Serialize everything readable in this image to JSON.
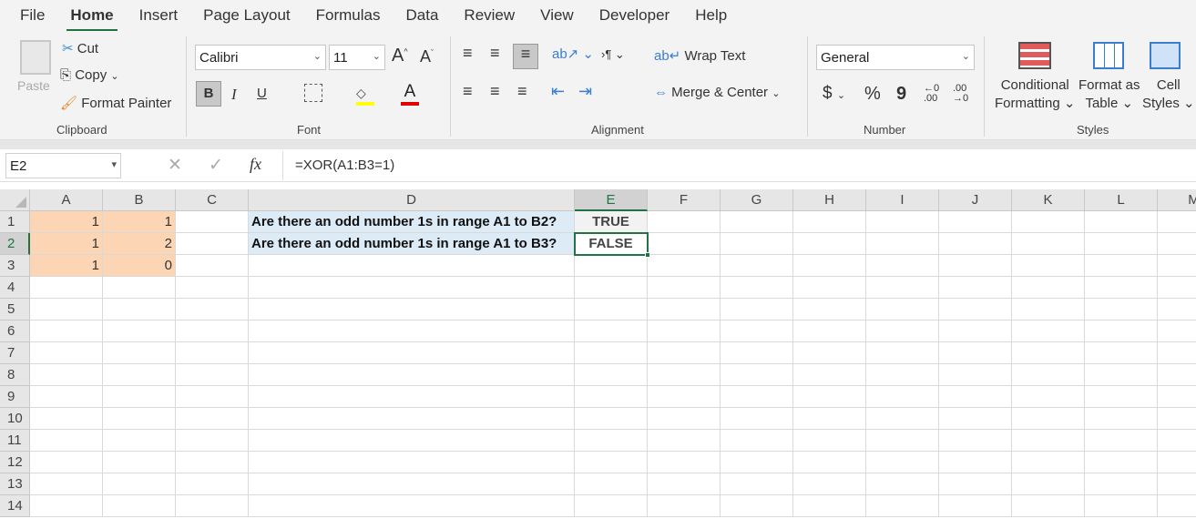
{
  "menu": [
    "File",
    "Home",
    "Insert",
    "Page Layout",
    "Formulas",
    "Data",
    "Review",
    "View",
    "Developer",
    "Help"
  ],
  "ribbon": {
    "clipboard": {
      "paste": "Paste",
      "cut": "Cut",
      "copy": "Copy",
      "format_painter": "Format Painter",
      "label": "Clipboard"
    },
    "font": {
      "name": "Calibri",
      "size": "11",
      "bold": "B",
      "italic": "I",
      "underline": "U",
      "label": "Font"
    },
    "alignment": {
      "wrap_text": "Wrap Text",
      "merge_center": "Merge & Center",
      "label": "Alignment"
    },
    "number": {
      "format": "General",
      "currency": "$",
      "percent": "%",
      "comma": "9",
      "label": "Number"
    },
    "styles": {
      "conditional": "Conditional",
      "formatting": "Formatting",
      "format_as": "Format as",
      "table": "Table",
      "cell": "Cell",
      "styles": "Styles",
      "label": "Styles"
    }
  },
  "formula_bar": {
    "name_box": "E2",
    "fx": "fx",
    "formula": "=XOR(A1:B3=1)"
  },
  "sheet": {
    "columns": [
      "A",
      "B",
      "C",
      "D",
      "E",
      "F",
      "G",
      "H",
      "I",
      "J",
      "K",
      "L",
      "M"
    ],
    "rows": [
      "1",
      "2",
      "3",
      "4",
      "5",
      "6",
      "7",
      "8",
      "9",
      "10",
      "11",
      "12",
      "13",
      "14"
    ],
    "selected_cell": "E2",
    "colors": {
      "input_fill": "#fcd5b4",
      "question_fill": "#ddebf7",
      "selection": "#217346"
    },
    "cells": [
      {
        "ref": "A1",
        "value": "1"
      },
      {
        "ref": "B1",
        "value": "1"
      },
      {
        "ref": "A2",
        "value": "1"
      },
      {
        "ref": "B2",
        "value": "2"
      },
      {
        "ref": "A3",
        "value": "1"
      },
      {
        "ref": "B3",
        "value": "0"
      },
      {
        "ref": "D1",
        "value": "Are there an odd number 1s in range A1 to B2?"
      },
      {
        "ref": "D2",
        "value": "Are there an odd number 1s in range A1 to B3?"
      },
      {
        "ref": "E1",
        "value": "TRUE"
      },
      {
        "ref": "E2",
        "value": "FALSE"
      }
    ]
  }
}
